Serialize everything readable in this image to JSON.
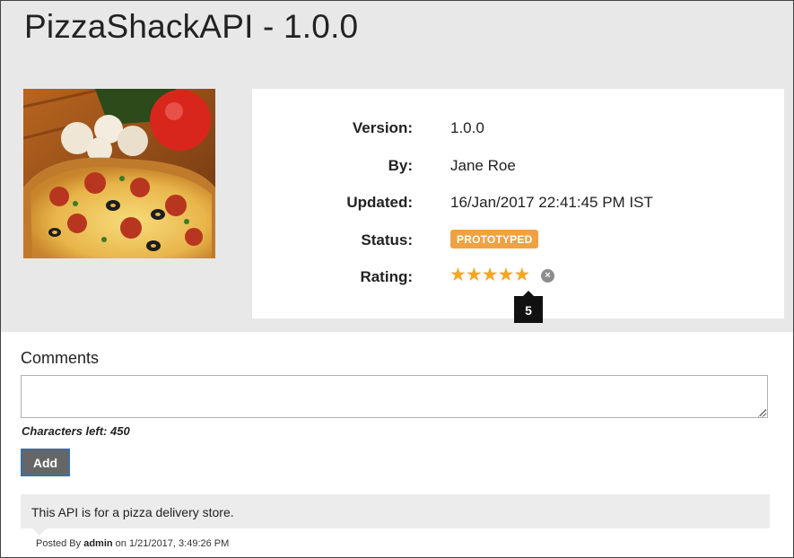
{
  "api": {
    "title": "PizzaShackAPI - 1.0.0",
    "thumbnail_alt": "pizza"
  },
  "info": {
    "version_label": "Version:",
    "version_value": "1.0.0",
    "by_label": "By:",
    "by_value": "Jane Roe",
    "updated_label": "Updated:",
    "updated_value": "16/Jan/2017 22:41:45 PM IST",
    "status_label": "Status:",
    "status_value": "PROTOTYPED",
    "rating_label": "Rating:",
    "rating_value": 5,
    "rating_max": 5,
    "rating_tooltip": "5",
    "status_color": "#f0a143",
    "star_color": "#f5a623"
  },
  "comments": {
    "heading": "Comments",
    "input_value": "",
    "chars_left": "Characters left: 450",
    "add_label": "Add",
    "items": [
      {
        "text": "This API is for a pizza delivery store.",
        "posted_by_prefix": "Posted By",
        "author": "admin",
        "on_prefix": "on",
        "timestamp": "1/21/2017, 3:49:26 PM"
      }
    ]
  }
}
